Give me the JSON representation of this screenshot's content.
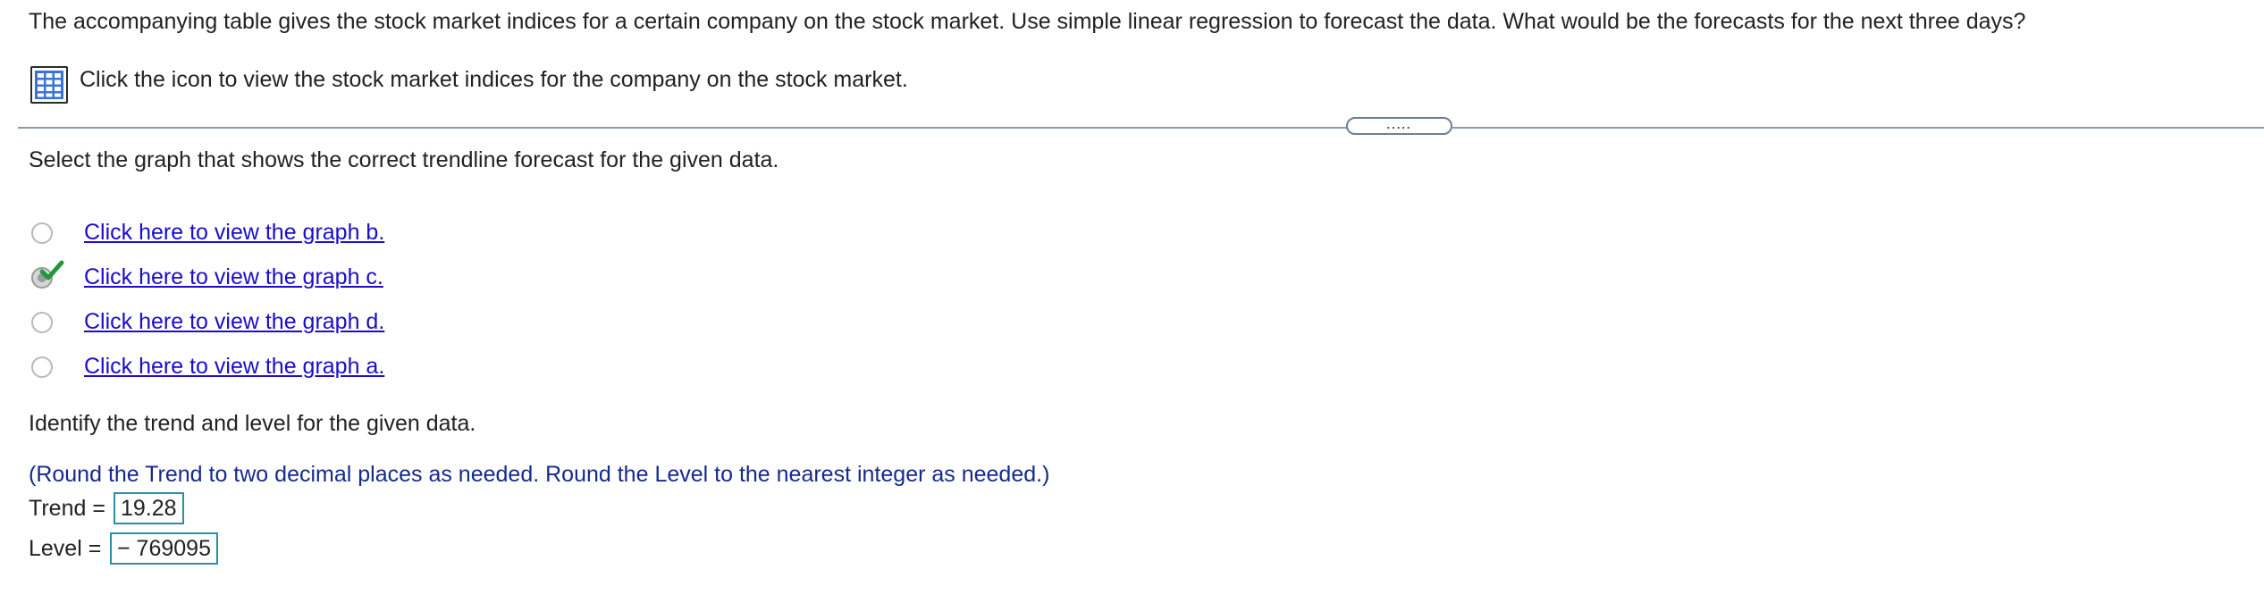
{
  "question": {
    "text": "The accompanying table gives the stock market indices for a certain company on the stock market. Use simple linear regression to forecast the data. What would be the forecasts for the next three days?"
  },
  "data_link": {
    "icon": "table-grid-icon",
    "text": "Click the icon to view the stock market indices for the company on the stock market."
  },
  "divider": {
    "handle_label": "....."
  },
  "graph_question": {
    "prompt": "Select the graph that shows the correct trendline forecast for the given data.",
    "options": [
      {
        "label": "Click here to view the graph b.",
        "selected": false
      },
      {
        "label": "Click here to view the graph c.",
        "selected": true,
        "correct": true
      },
      {
        "label": "Click here to view the graph d.",
        "selected": false
      },
      {
        "label": "Click here to view the graph a.",
        "selected": false
      }
    ]
  },
  "trend_level": {
    "prompt": "Identify the trend and level for the given data.",
    "rounding_note": "(Round the Trend to two decimal places as needed. Round the Level to the nearest integer as needed.)",
    "trend_label": "Trend =",
    "trend_value": "19.28",
    "level_label": "Level =",
    "level_value": "− 769095"
  },
  "colors": {
    "link": "#1a0dcc",
    "note": "#152a8c",
    "answer_box_border": "#2a8fa8",
    "icon_blue": "#3a73d6",
    "check_green": "#1f9a3a"
  }
}
